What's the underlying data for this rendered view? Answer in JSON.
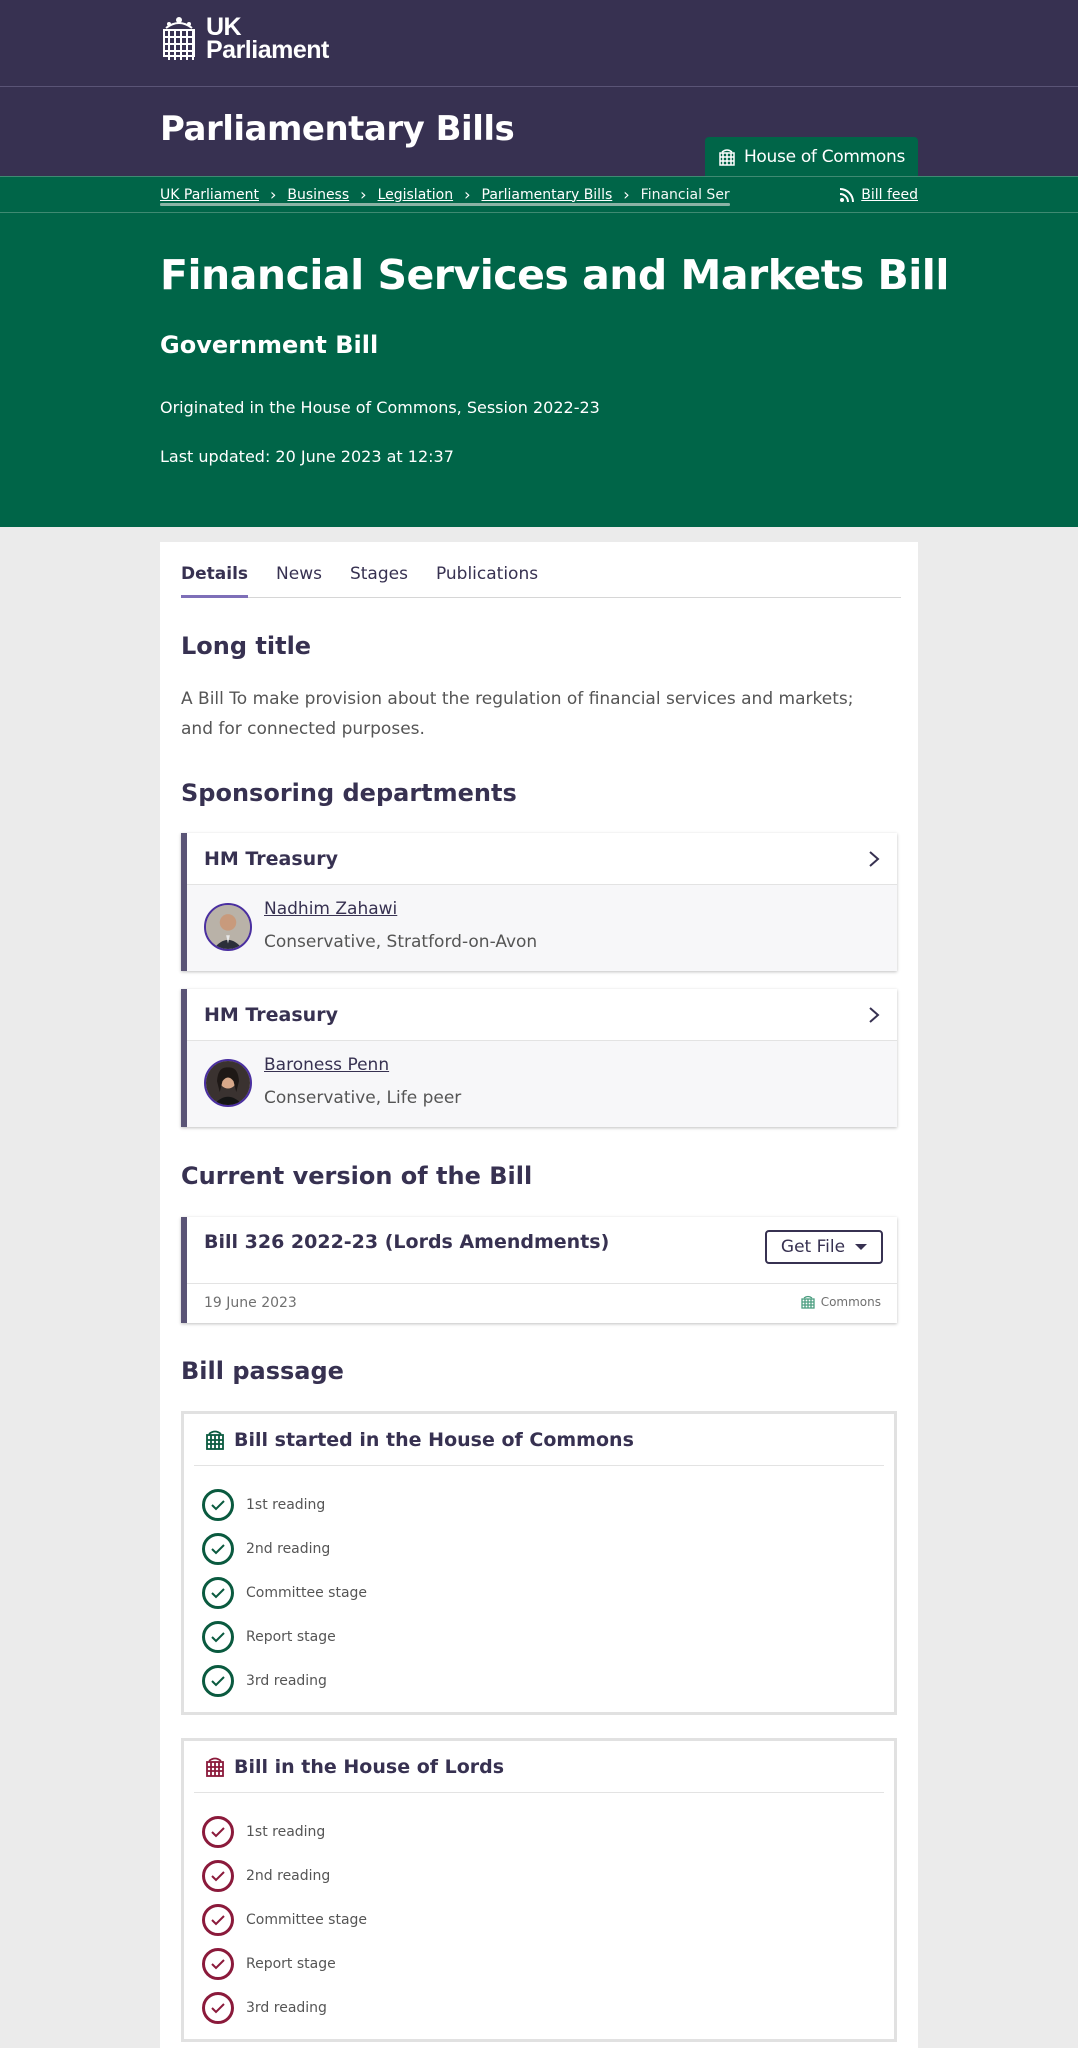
{
  "header": {
    "logo_text_line1": "UK",
    "logo_text_line2": "Parliament",
    "site_title": "Parliamentary Bills",
    "house_tab": "House of Commons"
  },
  "breadcrumbs": {
    "items": [
      "UK Parliament",
      "Business",
      "Legislation",
      "Parliamentary Bills"
    ],
    "current": "Financial Services and Markets Bill",
    "bill_feed": "Bill feed"
  },
  "hero": {
    "title": "Financial Services and Markets Bill",
    "subtitle": "Government Bill",
    "originated": "Originated in the House of Commons, Session 2022-23",
    "last_updated": "Last updated: 20 June 2023 at 12:37"
  },
  "tabs": [
    "Details",
    "News",
    "Stages",
    "Publications"
  ],
  "long_title": {
    "heading": "Long title",
    "text": "A Bill To make provision about the regulation of financial services and markets; and for connected purposes."
  },
  "sponsors": {
    "heading": "Sponsoring departments",
    "items": [
      {
        "department": "HM Treasury",
        "name": "Nadhim Zahawi",
        "party": "Conservative, Stratford-on-Avon"
      },
      {
        "department": "HM Treasury",
        "name": "Baroness Penn",
        "party": "Conservative, Life peer"
      }
    ]
  },
  "current_version": {
    "heading": "Current version of the Bill",
    "title": "Bill 326 2022-23 (Lords Amendments)",
    "button": "Get File",
    "date": "19 June 2023",
    "house": "Commons"
  },
  "passage": {
    "heading": "Bill passage",
    "commons": {
      "title": "Bill started in the House of Commons",
      "stages": [
        "1st reading",
        "2nd reading",
        "Committee stage",
        "Report stage",
        "3rd reading"
      ]
    },
    "lords": {
      "title": "Bill in the House of Lords",
      "stages": [
        "1st reading",
        "2nd reading",
        "Committee stage",
        "Report stage",
        "3rd reading"
      ]
    }
  },
  "colors": {
    "header_purple": "#373151",
    "commons_green": "#006548",
    "lords_red": "#8b1a3b",
    "tab_accent": "#7e6fb8"
  },
  "icons": [
    "portcullis-icon",
    "rss-icon",
    "chevron-right-icon",
    "caret-down-icon",
    "check-icon"
  ]
}
